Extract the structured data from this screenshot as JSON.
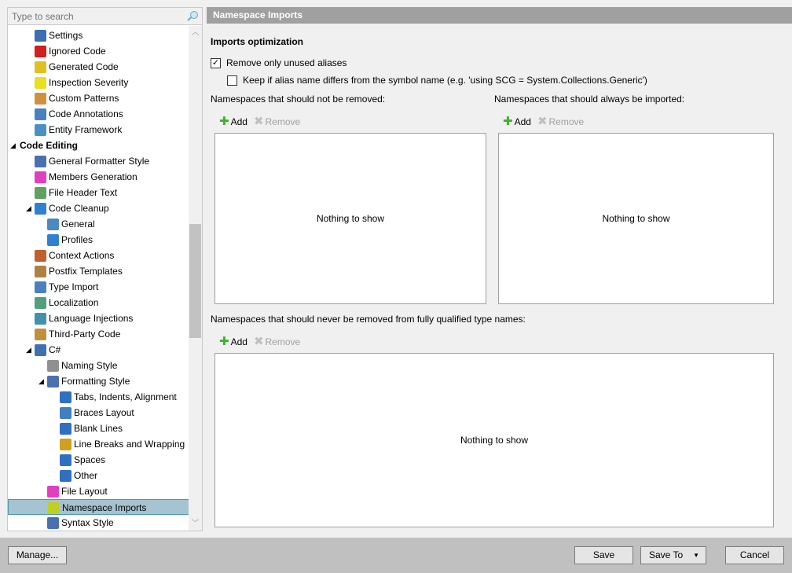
{
  "search": {
    "placeholder": "Type to search"
  },
  "tree": [
    {
      "label": "Settings",
      "level": 1,
      "color": "#3a6fb0"
    },
    {
      "label": "Ignored Code",
      "level": 1,
      "color": "#d02020"
    },
    {
      "label": "Generated Code",
      "level": 1,
      "color": "#e0c020"
    },
    {
      "label": "Inspection Severity",
      "level": 1,
      "color": "#e8e020"
    },
    {
      "label": "Custom Patterns",
      "level": 1,
      "color": "#d09040"
    },
    {
      "label": "Code Annotations",
      "level": 1,
      "color": "#4a80c0"
    },
    {
      "label": "Entity Framework",
      "level": 1,
      "color": "#4a90c0"
    },
    {
      "label": "Code Editing",
      "level": 0,
      "expanded": true
    },
    {
      "label": "General Formatter Style",
      "level": 1,
      "color": "#4a70b0"
    },
    {
      "label": "Members Generation",
      "level": 1,
      "color": "#e040c0"
    },
    {
      "label": "File Header Text",
      "level": 1,
      "color": "#60a060"
    },
    {
      "label": "Code Cleanup",
      "level": 1,
      "expanded": true,
      "color": "#3080d0"
    },
    {
      "label": "General",
      "level": 2,
      "color": "#4a8ac0"
    },
    {
      "label": "Profiles",
      "level": 2,
      "color": "#3080d0"
    },
    {
      "label": "Context Actions",
      "level": 1,
      "color": "#c06030"
    },
    {
      "label": "Postfix Templates",
      "level": 1,
      "color": "#b08040"
    },
    {
      "label": "Type Import",
      "level": 1,
      "color": "#4a80c0"
    },
    {
      "label": "Localization",
      "level": 1,
      "color": "#50a080"
    },
    {
      "label": "Language Injections",
      "level": 1,
      "color": "#4090b0"
    },
    {
      "label": "Third-Party Code",
      "level": 1,
      "color": "#c09040"
    },
    {
      "label": "C#",
      "level": 1,
      "expanded": true,
      "color": "#4070b0"
    },
    {
      "label": "Naming Style",
      "level": 2,
      "color": "#909090"
    },
    {
      "label": "Formatting Style",
      "level": 2,
      "expanded": true,
      "color": "#4a70b0"
    },
    {
      "label": "Tabs, Indents, Alignment",
      "level": 3,
      "color": "#3070c0"
    },
    {
      "label": "Braces Layout",
      "level": 3,
      "color": "#4080c0"
    },
    {
      "label": "Blank Lines",
      "level": 3,
      "color": "#3070c0"
    },
    {
      "label": "Line Breaks and Wrapping",
      "level": 3,
      "color": "#d0a020"
    },
    {
      "label": "Spaces",
      "level": 3,
      "color": "#3070c0"
    },
    {
      "label": "Other",
      "level": 3,
      "color": "#3070c0"
    },
    {
      "label": "File Layout",
      "level": 2,
      "color": "#e040c0"
    },
    {
      "label": "Namespace Imports",
      "level": 2,
      "selected": true,
      "color": "#c0d020"
    },
    {
      "label": "Syntax Style",
      "level": 2,
      "color": "#4a70b0"
    }
  ],
  "panel": {
    "title": "Namespace Imports",
    "section": "Imports optimization",
    "remove_unused": {
      "label": "Remove only unused aliases",
      "checked": true
    },
    "keep_alias": {
      "label": "Keep if alias name differs from the symbol name (e.g. 'using SCG = System.Collections.Generic')",
      "checked": false
    },
    "list1": {
      "label": "Namespaces that should not be removed:",
      "empty": "Nothing to show"
    },
    "list2": {
      "label": "Namespaces that should always be imported:",
      "empty": "Nothing to show"
    },
    "list3": {
      "label": "Namespaces that should never be removed from fully qualified type names:",
      "empty": "Nothing to show"
    },
    "add": "Add",
    "remove": "Remove"
  },
  "footer": {
    "manage": "Manage...",
    "save": "Save",
    "save_to": "Save To",
    "cancel": "Cancel"
  }
}
